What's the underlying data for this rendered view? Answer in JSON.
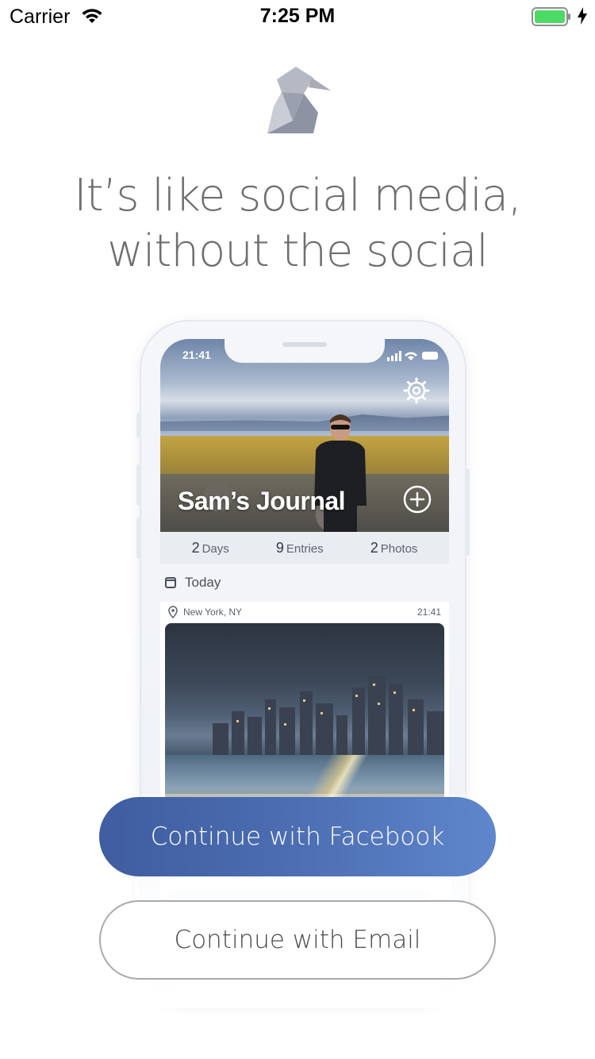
{
  "status_bar": {
    "carrier": "Carrier",
    "time": "7:25 PM",
    "battery_color": "#4cd964"
  },
  "logo": {
    "icon": "origami-bird-icon"
  },
  "tagline": {
    "line1": "It’s like social media,",
    "line2": "without the social"
  },
  "mockup": {
    "status_time": "21:41",
    "journal_title": "Sam’s Journal",
    "stats": [
      {
        "value": "2",
        "label": "Days"
      },
      {
        "value": "9",
        "label": "Entries"
      },
      {
        "value": "2",
        "label": "Photos"
      }
    ],
    "section_label": "Today",
    "entry": {
      "location": "New York, NY",
      "time": "21:41"
    }
  },
  "buttons": {
    "facebook": "Continue with Facebook",
    "email": "Continue with Email",
    "facebook_color": "#4b6cb0"
  }
}
